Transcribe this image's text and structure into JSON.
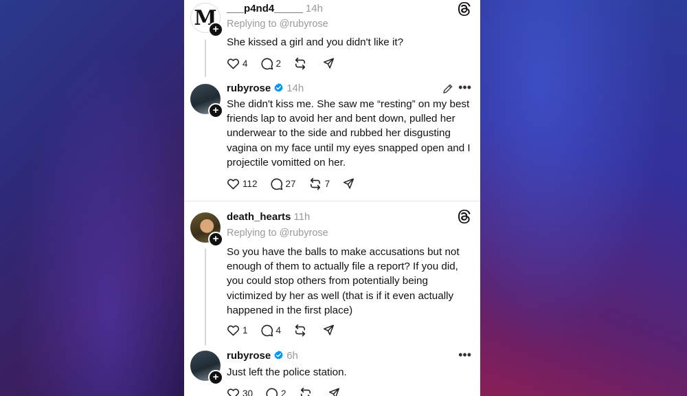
{
  "posts": [
    {
      "username": "___p4nd4_____",
      "time": "14h",
      "replying": "Replying to @rubyrose",
      "text": "She kissed a girl and you didn't like it?",
      "likes": "4",
      "replies": "2",
      "reposts": "",
      "avatar_letter": "M",
      "header_icon": "threads-icon"
    },
    {
      "username": "rubyrose",
      "time": "14h",
      "verified": true,
      "text": "She didn't kiss me. She saw me “resting” on my best friends lap to avoid her and bent down, pulled her underwear to the side and rubbed her disgusting vagina on my face until my eyes snapped open and I projectile vomitted on her.",
      "likes": "112",
      "replies": "27",
      "reposts": "7"
    },
    {
      "username": "death_hearts",
      "time": "11h",
      "replying": "Replying to @rubyrose",
      "text": "So you have the balls to make accusations but not enough of them to actually file a report? If you did, you could stop others from potentially being victimized by her as well (that is if it even actually happened in the first place)",
      "likes": "1",
      "replies": "4",
      "reposts": "",
      "header_icon": "threads-icon"
    },
    {
      "username": "rubyrose",
      "time": "6h",
      "verified": true,
      "text": "Just left the police station.",
      "likes": "30",
      "replies": "2",
      "reposts": ""
    }
  ],
  "colors": {
    "verified": "#0095f6",
    "muted": "#999999",
    "text": "#111111"
  }
}
